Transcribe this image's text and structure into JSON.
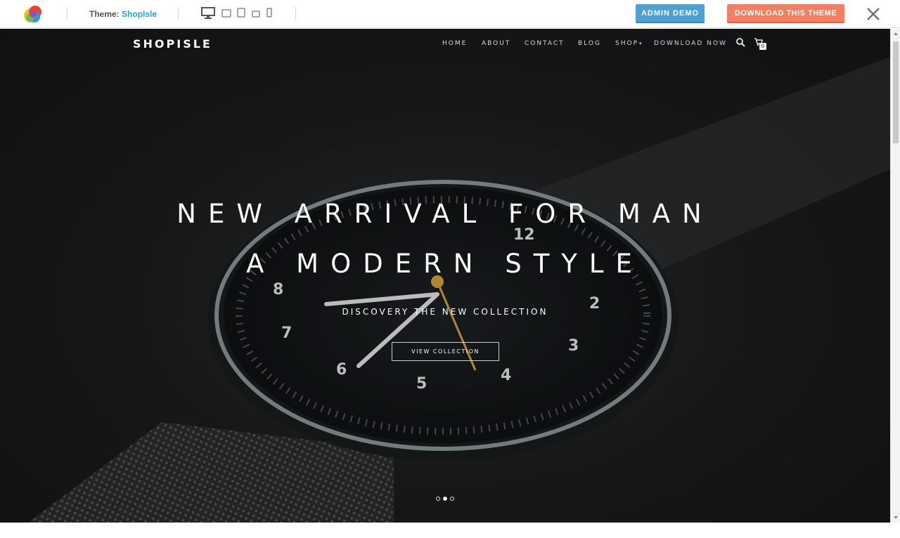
{
  "toolbar": {
    "theme_prefix": "Theme:",
    "theme_name": "ShopIsle",
    "admin_demo_label": "ADMIN DEMO",
    "download_label": "DOWNLOAD THIS THEME",
    "device_icons": [
      "desktop-icon",
      "laptop-icon",
      "tablet-icon",
      "tablet-landscape-icon",
      "phone-icon"
    ],
    "close_icon": "close-icon",
    "colors": {
      "admin": "#4ea0d0",
      "download": "#f07f64",
      "theme_name": "#2d9fd8"
    }
  },
  "site": {
    "brand": "SHOPISLE",
    "nav": [
      "HOME",
      "ABOUT",
      "CONTACT",
      "BLOG",
      "SHOP",
      "DOWNLOAD NOW"
    ],
    "cart_count": "0",
    "icons": [
      "search-icon",
      "cart-icon"
    ]
  },
  "hero": {
    "headline_1": "NEW ARRIVAL FOR MAN",
    "headline_2": "A MODERN STYLE",
    "subheadline": "DISCOVERY THE NEW COLLECTION",
    "cta_label": "VIEW COLLECTION",
    "slides": 3,
    "active_slide": 2
  }
}
